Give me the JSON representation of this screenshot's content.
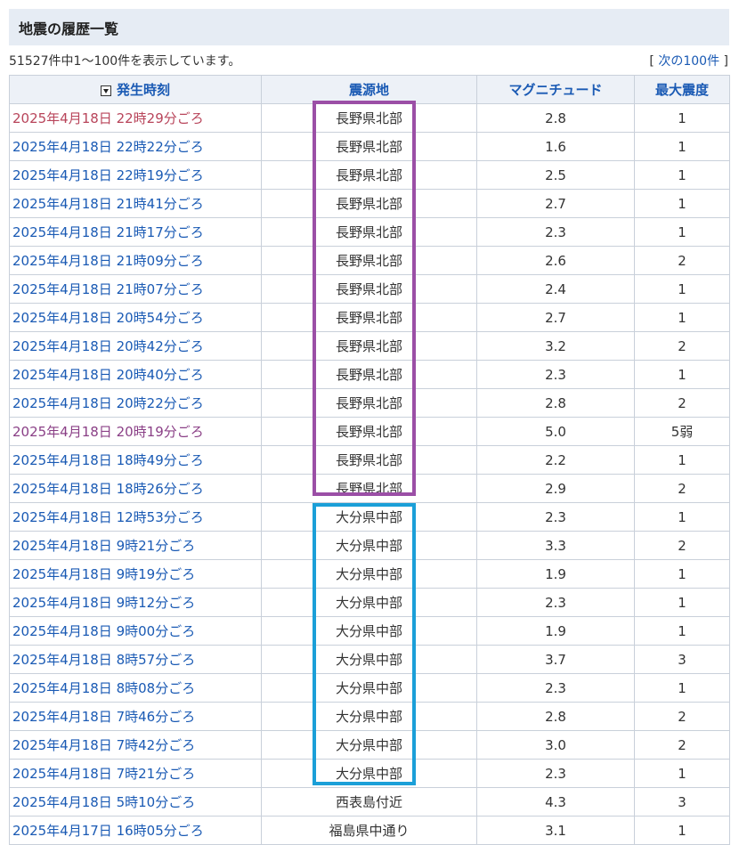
{
  "header": {
    "title": "地震の履歴一覧"
  },
  "summary": "51527件中1〜100件を表示しています。",
  "pagination": {
    "bracket_open": "[ ",
    "next_label": "次の100件",
    "bracket_close": " ]"
  },
  "table": {
    "columns": [
      "発生時刻",
      "震源地",
      "マグニチュード",
      "最大震度"
    ],
    "rows": [
      {
        "time": "2025年4月18日 22時29分ごろ",
        "epicenter": "長野県北部",
        "magnitude": "2.8",
        "intensity": "1"
      },
      {
        "time": "2025年4月18日 22時22分ごろ",
        "epicenter": "長野県北部",
        "magnitude": "1.6",
        "intensity": "1"
      },
      {
        "time": "2025年4月18日 22時19分ごろ",
        "epicenter": "長野県北部",
        "magnitude": "2.5",
        "intensity": "1"
      },
      {
        "time": "2025年4月18日 21時41分ごろ",
        "epicenter": "長野県北部",
        "magnitude": "2.7",
        "intensity": "1"
      },
      {
        "time": "2025年4月18日 21時17分ごろ",
        "epicenter": "長野県北部",
        "magnitude": "2.3",
        "intensity": "1"
      },
      {
        "time": "2025年4月18日 21時09分ごろ",
        "epicenter": "長野県北部",
        "magnitude": "2.6",
        "intensity": "2"
      },
      {
        "time": "2025年4月18日 21時07分ごろ",
        "epicenter": "長野県北部",
        "magnitude": "2.4",
        "intensity": "1"
      },
      {
        "time": "2025年4月18日 20時54分ごろ",
        "epicenter": "長野県北部",
        "magnitude": "2.7",
        "intensity": "1"
      },
      {
        "time": "2025年4月18日 20時42分ごろ",
        "epicenter": "長野県北部",
        "magnitude": "3.2",
        "intensity": "2"
      },
      {
        "time": "2025年4月18日 20時40分ごろ",
        "epicenter": "長野県北部",
        "magnitude": "2.3",
        "intensity": "1"
      },
      {
        "time": "2025年4月18日 20時22分ごろ",
        "epicenter": "長野県北部",
        "magnitude": "2.8",
        "intensity": "2"
      },
      {
        "time": "2025年4月18日 20時19分ごろ",
        "epicenter": "長野県北部",
        "magnitude": "5.0",
        "intensity": "5弱"
      },
      {
        "time": "2025年4月18日 18時49分ごろ",
        "epicenter": "長野県北部",
        "magnitude": "2.2",
        "intensity": "1"
      },
      {
        "time": "2025年4月18日 18時26分ごろ",
        "epicenter": "長野県北部",
        "magnitude": "2.9",
        "intensity": "2"
      },
      {
        "time": "2025年4月18日 12時53分ごろ",
        "epicenter": "大分県中部",
        "magnitude": "2.3",
        "intensity": "1"
      },
      {
        "time": "2025年4月18日 9時21分ごろ",
        "epicenter": "大分県中部",
        "magnitude": "3.3",
        "intensity": "2"
      },
      {
        "time": "2025年4月18日 9時19分ごろ",
        "epicenter": "大分県中部",
        "magnitude": "1.9",
        "intensity": "1"
      },
      {
        "time": "2025年4月18日 9時12分ごろ",
        "epicenter": "大分県中部",
        "magnitude": "2.3",
        "intensity": "1"
      },
      {
        "time": "2025年4月18日 9時00分ごろ",
        "epicenter": "大分県中部",
        "magnitude": "1.9",
        "intensity": "1"
      },
      {
        "time": "2025年4月18日 8時57分ごろ",
        "epicenter": "大分県中部",
        "magnitude": "3.7",
        "intensity": "3"
      },
      {
        "time": "2025年4月18日 8時08分ごろ",
        "epicenter": "大分県中部",
        "magnitude": "2.3",
        "intensity": "1"
      },
      {
        "time": "2025年4月18日 7時46分ごろ",
        "epicenter": "大分県中部",
        "magnitude": "2.8",
        "intensity": "2"
      },
      {
        "time": "2025年4月18日 7時42分ごろ",
        "epicenter": "大分県中部",
        "magnitude": "3.0",
        "intensity": "2"
      },
      {
        "time": "2025年4月18日 7時21分ごろ",
        "epicenter": "大分県中部",
        "magnitude": "2.3",
        "intensity": "1"
      },
      {
        "time": "2025年4月18日 5時10分ごろ",
        "epicenter": "西表島付近",
        "magnitude": "4.3",
        "intensity": "3"
      },
      {
        "time": "2025年4月17日 16時05分ごろ",
        "epicenter": "福島県中通り",
        "magnitude": "3.1",
        "intensity": "1"
      }
    ]
  },
  "colors": {
    "link": "#1a5ab4",
    "visited_red": "#b8445a",
    "visited_purple": "#8a3f86",
    "highlight_purple": "#9b4fa6",
    "highlight_blue": "#1b9fd8"
  },
  "icons": {
    "sort": "sort-desc-icon"
  }
}
